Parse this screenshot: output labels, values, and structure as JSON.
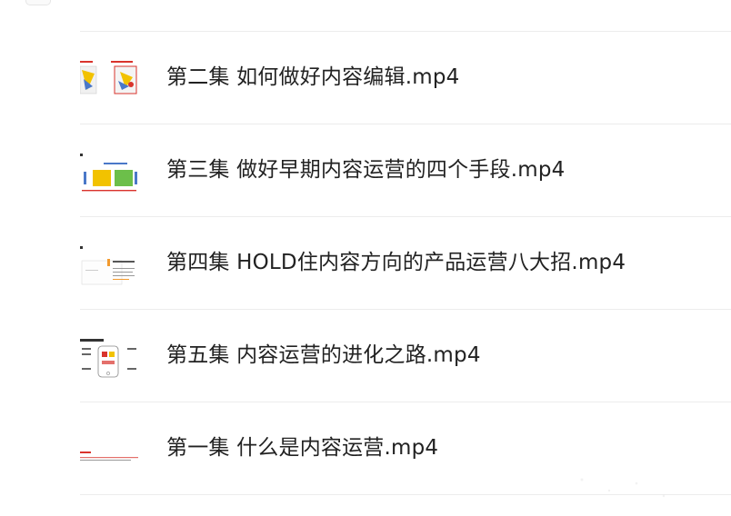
{
  "file_list": {
    "items": [
      {
        "name": "第二集 如何做好内容编辑.mp4",
        "thumb_icon": "video-thumbnail-icon"
      },
      {
        "name": "第三集 做好早期内容运营的四个手段.mp4",
        "thumb_icon": "video-thumbnail-icon"
      },
      {
        "name": "第四集 HOLD住内容方向的产品运营八大招.mp4",
        "thumb_icon": "video-thumbnail-icon"
      },
      {
        "name": "第五集 内容运营的进化之路.mp4",
        "thumb_icon": "video-thumbnail-icon"
      },
      {
        "name": "第一集 什么是内容运营.mp4",
        "thumb_icon": "video-thumbnail-icon"
      }
    ]
  },
  "colors": {
    "text": "#222222",
    "divider": "#ececec",
    "thumb_accent_red": "#d9332c",
    "thumb_accent_yellow": "#f2c200",
    "thumb_accent_blue": "#4a78c8"
  }
}
